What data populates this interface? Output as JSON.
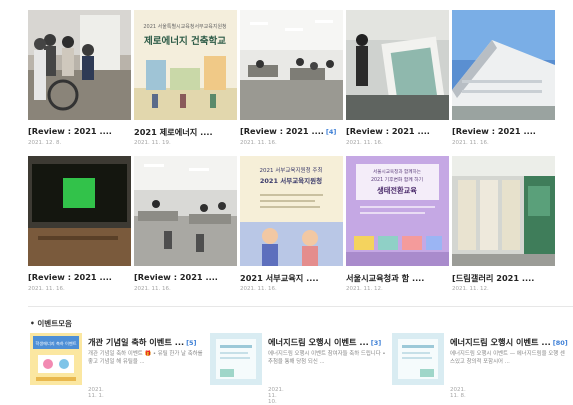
{
  "cards": [
    {
      "title": "[Review : 2021 ....",
      "badge": "",
      "date": "2021. 12. 8."
    },
    {
      "title": "2021 제로에너지 ....",
      "badge": "",
      "date": "2021. 11. 19."
    },
    {
      "title": "[Review : 2021 ....",
      "badge": "[4]",
      "date": "2021. 11. 16."
    },
    {
      "title": "[Review : 2021 ....",
      "badge": "",
      "date": "2021. 11. 16."
    },
    {
      "title": "[Review : 2021 ....",
      "badge": "",
      "date": "2021. 11. 16."
    },
    {
      "title": "[Review : 2021 ....",
      "badge": "",
      "date": "2021. 11. 16."
    },
    {
      "title": "[Review : 2021 ....",
      "badge": "",
      "date": "2021. 11. 16."
    },
    {
      "title": "2021 서부교육지 ....",
      "badge": "",
      "date": "2021. 11. 16."
    },
    {
      "title": "서울시교육청과 함 ....",
      "badge": "",
      "date": "2021. 11. 12."
    },
    {
      "title": "[드림갤러리 2021 ....",
      "badge": "",
      "date": "2021. 11. 12."
    }
  ],
  "thumb_text": {
    "poster2_top": "2021 서울특별시교육청서부교육지원청",
    "poster2_title": "제로에너지 건축학교",
    "poster8_line1": "2021 서부교육지원청 주최",
    "poster8_line2": "2021 서부교육지원청",
    "poster9_line1": "서울시교육청과 함께하는",
    "poster9_line2": "2021 기후변화 함께 하기",
    "poster9_title": "생태전환교육",
    "ev1_poster": "학생에너지 축하 이벤트"
  },
  "section": {
    "title": "• 이벤트모음"
  },
  "events": [
    {
      "title": "개관 기념일 축하 이벤트 ...",
      "badge": "[5]",
      "desc": "개관 기념일 축하 이벤트 🎁 • 유틸 한가 날 축하를 좋고 기념일 해 유틸을 ...",
      "date": "2021. 11. 1."
    },
    {
      "title": "에너지드림 오행시 이벤트 ...",
      "badge": "[3]",
      "desc": "에너지드림 오행시 이벤트 참여자들 축하 드립니다 • 추첨을 통해 당첨 되신 ...",
      "date": "2021. 11. 10."
    },
    {
      "title": "에너지드림 오행시 이벤트 ...",
      "badge": "[80]",
      "desc": "에너지드림 오행시 이벤트 — 에너지드림을 오행 센스있고 창의적 포함시어 ...",
      "date": "2021. 11. 8."
    }
  ]
}
